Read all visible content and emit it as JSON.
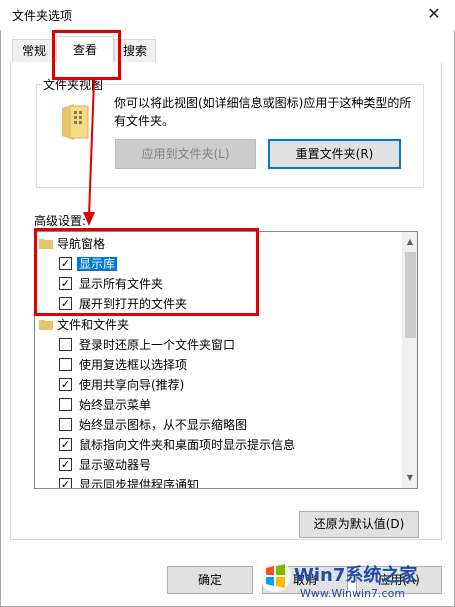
{
  "window": {
    "title": "文件夹选项",
    "close_symbol": "✕"
  },
  "tabs": [
    {
      "label": "常规"
    },
    {
      "label": "查看"
    },
    {
      "label": "搜索"
    }
  ],
  "folder_views": {
    "group_label": "文件夹视图",
    "description": "你可以将此视图(如详细信息或图标)应用于这种类型的所有文件夹。",
    "apply_button": "应用到文件夹(L)",
    "reset_button": "重置文件夹(R)"
  },
  "advanced": {
    "label": "高级设置:",
    "items": [
      {
        "text": "导航窗格",
        "type": "folder"
      },
      {
        "text": "显示库",
        "type": "checkbox",
        "checked": true,
        "selected": true
      },
      {
        "text": "显示所有文件夹",
        "type": "checkbox",
        "checked": true
      },
      {
        "text": "展开到打开的文件夹",
        "type": "checkbox",
        "checked": true
      },
      {
        "text": "文件和文件夹",
        "type": "folder"
      },
      {
        "text": "登录时还原上一个文件夹窗口",
        "type": "checkbox",
        "checked": false
      },
      {
        "text": "使用复选框以选择项",
        "type": "checkbox",
        "checked": false
      },
      {
        "text": "使用共享向导(推荐)",
        "type": "checkbox",
        "checked": true
      },
      {
        "text": "始终显示菜单",
        "type": "checkbox",
        "checked": false
      },
      {
        "text": "始终显示图标，从不显示缩略图",
        "type": "checkbox",
        "checked": false
      },
      {
        "text": "鼠标指向文件夹和桌面项时显示提示信息",
        "type": "checkbox",
        "checked": true
      },
      {
        "text": "显示驱动器号",
        "type": "checkbox",
        "checked": true
      },
      {
        "text": "显示同步提供程序通知",
        "type": "checkbox",
        "checked": true
      }
    ]
  },
  "restore_defaults": "还原为默认值(D)",
  "footer": {
    "ok": "确定",
    "cancel": "取消",
    "apply": "应用(A)"
  },
  "watermark": {
    "brand": "Win7系统之家",
    "url": "Www.Winwin7.com"
  },
  "colors": {
    "annotation_red": "#e00000",
    "selection_blue": "#0078d7"
  }
}
